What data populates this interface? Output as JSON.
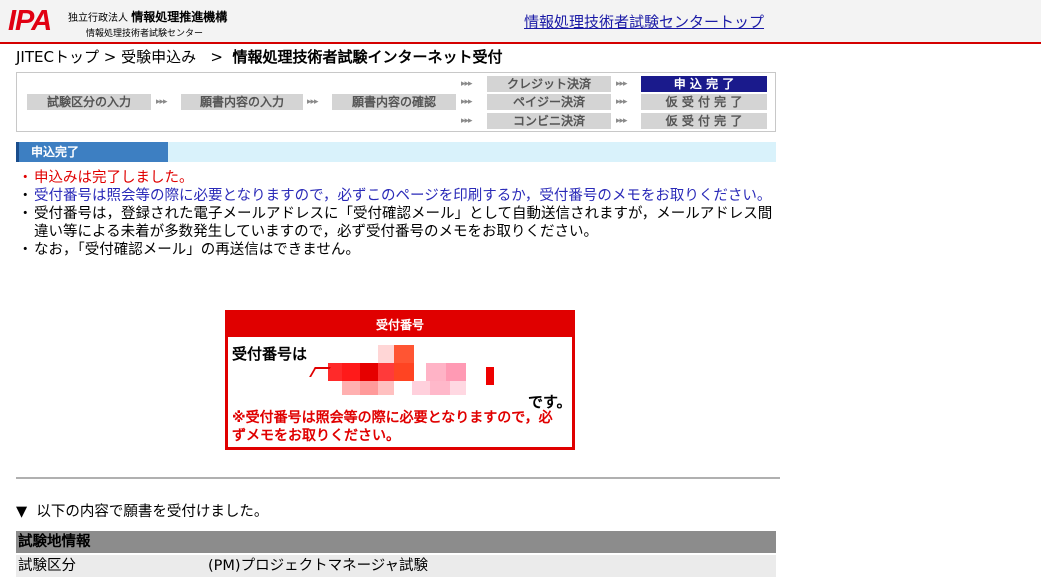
{
  "header": {
    "logo": "IPA",
    "org_prefix": "独立行政法人",
    "org_name": "情報処理推進機構",
    "org_center": "情報処理技術者試験センター",
    "top_link": "情報処理技術者試験センタートップ"
  },
  "breadcrumb": {
    "item1": "JITECトップ",
    "sep1": " > ",
    "item2": "受験申込み",
    "sep2": " > ",
    "current": "情報処理技術者試験インターネット受付"
  },
  "steps": {
    "step1": "試験区分の入力",
    "step2": "願書内容の入力",
    "step3": "願書内容の確認",
    "pay_credit": "クレジット決済",
    "pay_payeasy": "ペイジー決済",
    "pay_convenience": "コンビニ決済",
    "done_credit": "申 込 完 了",
    "done_payeasy": "仮 受 付 完 了",
    "done_convenience": "仮 受 付 完 了",
    "arrow": "▸▸▸"
  },
  "section": {
    "title": "申込完了"
  },
  "notes": {
    "bullet": "・",
    "n1": "申込みは完了しました。",
    "n2": "受付番号は照会等の際に必要となりますので，必ずこのページを印刷するか，受付番号のメモをお取りください。",
    "n3": "受付番号は，登録された電子メールアドレスに「受付確認メール」として自動送信されますが，メールアドレス間違い等による未着が多数発生していますので，必ず受付番号のメモをお取りください。",
    "n4": "なお，「受付確認メール」の再送信はできません。"
  },
  "receipt_box": {
    "title": "受付番号",
    "label": "受付番号は",
    "suffix": "です。",
    "warning": "※受付番号は照会等の際に必要となりますので，必ずメモをお取りください。"
  },
  "received": {
    "marker": "▼",
    "text": "以下の内容で願書を受付けました。"
  },
  "table": {
    "heading": "試験地情報",
    "rows": [
      {
        "key": "試験区分",
        "value": "(PM)プロジェクトマネージャ試験"
      }
    ]
  },
  "colors": {
    "accent_red": "#e00000",
    "link_blue": "#1a1aa6",
    "active_step": "#1a1a8c"
  }
}
